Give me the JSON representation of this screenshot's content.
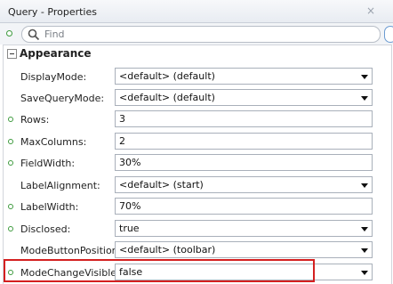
{
  "window": {
    "title": "Query - Properties",
    "close_glyph": "×"
  },
  "search": {
    "placeholder": "Find",
    "icon": "search-icon"
  },
  "section": {
    "label": "Appearance",
    "expander": "collapse-box-icon"
  },
  "properties": [
    {
      "name": "DisplayMode",
      "value": "<default> (default)",
      "type": "select",
      "set": false
    },
    {
      "name": "SaveQueryMode",
      "value": "<default> (default)",
      "type": "select",
      "set": false
    },
    {
      "name": "Rows",
      "value": "3",
      "type": "text",
      "set": true
    },
    {
      "name": "MaxColumns",
      "value": "2",
      "type": "text",
      "set": true
    },
    {
      "name": "FieldWidth",
      "value": "30%",
      "type": "text",
      "set": true
    },
    {
      "name": "LabelAlignment",
      "value": "<default> (start)",
      "type": "select",
      "set": false
    },
    {
      "name": "LabelWidth",
      "value": "70%",
      "type": "text",
      "set": true
    },
    {
      "name": "Disclosed",
      "value": "true",
      "type": "select",
      "set": true
    },
    {
      "name": "ModeButtonPosition",
      "value": "<default> (toolbar)",
      "type": "select",
      "set": false
    },
    {
      "name": "ModeChangeVisible",
      "value": "false",
      "type": "select",
      "set": true
    }
  ],
  "colors": {
    "set_marker": "#3d9a3d",
    "highlight": "#d42020"
  }
}
